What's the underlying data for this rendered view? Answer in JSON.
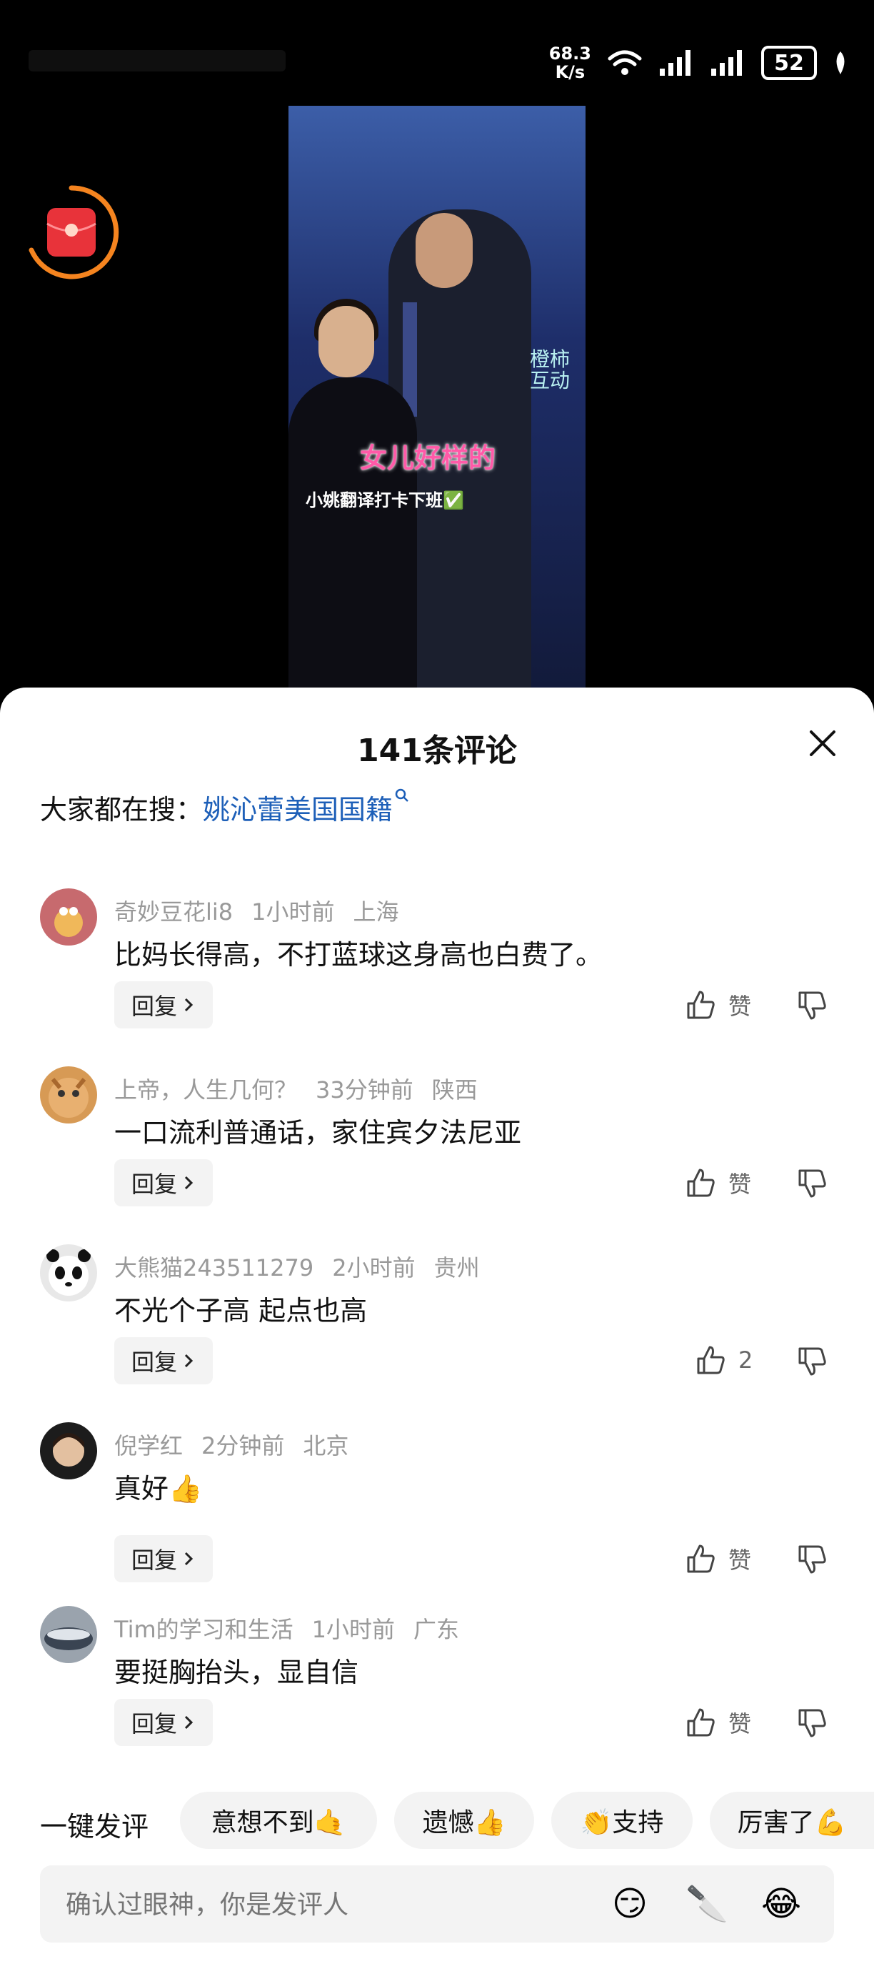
{
  "status_bar": {
    "net_speed_value": "68.3",
    "net_speed_unit": "K/s",
    "battery": "52"
  },
  "video": {
    "overlay_title": "女儿好样的",
    "overlay_subtitle": "小姚翻译打卡下班✅",
    "overlay_brand": "橙柿互动"
  },
  "comments_sheet": {
    "title": "141条评论",
    "search_prefix": "大家都在搜：",
    "search_keyword": "姚沁蕾美国国籍",
    "comments": [
      {
        "user": "奇妙豆花li8",
        "time": "1小时前",
        "location": "上海",
        "text": "比妈长得高，不打蓝球这身高也白费了。",
        "reply_label": "回复",
        "like_label": "赞"
      },
      {
        "user": "上帝，人生几何？",
        "time": "33分钟前",
        "location": "陕西",
        "text": "一口流利普通话，家住宾夕法尼亚",
        "reply_label": "回复",
        "like_label": "赞"
      },
      {
        "user": "大熊猫243511279",
        "time": "2小时前",
        "location": "贵州",
        "text": "不光个子高 起点也高",
        "reply_label": "回复",
        "like_label": "2"
      },
      {
        "user": "倪学红",
        "time": "2分钟前",
        "location": "北京",
        "text": "真好👍",
        "reply_label": "回复",
        "like_label": "赞"
      },
      {
        "user": "Tim的学习和生活",
        "time": "1小时前",
        "location": "广东",
        "text": "要挺胸抬头，显自信",
        "reply_label": "回复",
        "like_label": "赞"
      }
    ],
    "quick_comment_label": "一键发评",
    "quick_chips": [
      "意想不到🤙",
      "遗憾👍",
      "👏支持",
      "厉害了💪"
    ],
    "input_placeholder": "确认过眼神，你是发评人",
    "input_icons": [
      "emoji-smirk-icon",
      "cleaver-icon",
      "emoji-laugh-cry-icon"
    ]
  }
}
